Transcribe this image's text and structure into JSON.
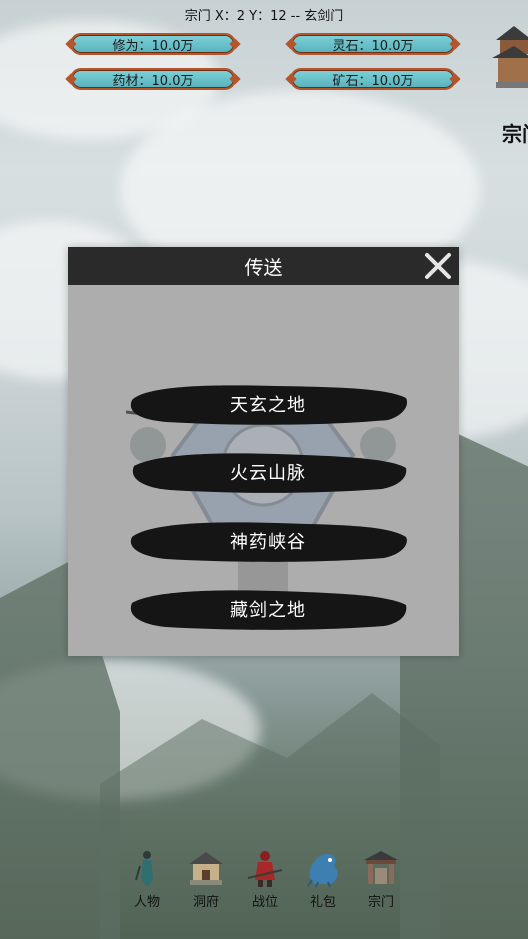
{
  "header": {
    "location": "宗门 X：2 Y：12 -- 玄剑门"
  },
  "resources": [
    {
      "label": "修为：10.0万"
    },
    {
      "label": "灵石：10.0万"
    },
    {
      "label": "药材：10.0万"
    },
    {
      "label": "矿石：10.0万"
    }
  ],
  "sect_top": {
    "label": "宗门"
  },
  "modal": {
    "title": "传送",
    "destinations": [
      "天玄之地",
      "火云山脉",
      "神药峡谷",
      "藏剑之地"
    ]
  },
  "nav": [
    {
      "label": "人物",
      "icon": "character-icon"
    },
    {
      "label": "洞府",
      "icon": "cave-dwelling-icon"
    },
    {
      "label": "战位",
      "icon": "battle-position-icon"
    },
    {
      "label": "礼包",
      "icon": "gift-pack-icon"
    },
    {
      "label": "宗门",
      "icon": "sect-gate-icon"
    }
  ],
  "colors": {
    "resource_fill": "#6cc3cb",
    "resource_border": "#b4552b",
    "modal_header": "#2a2a2a",
    "modal_body": "#adadad"
  }
}
